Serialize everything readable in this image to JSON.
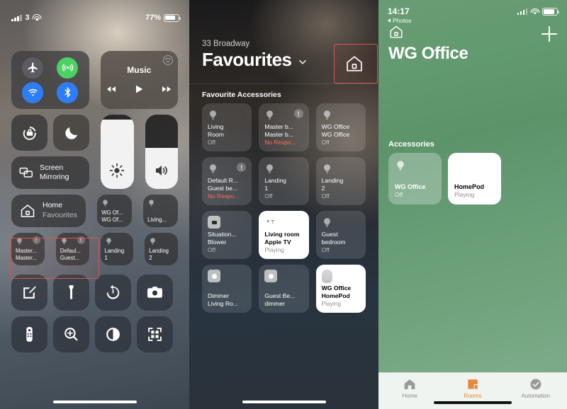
{
  "panel1": {
    "name": "control-centre",
    "status": {
      "carrier": "3",
      "battery_percent": "77%",
      "battery_level": 77
    },
    "connectivity": {
      "airplane": "airplane-mode",
      "cellular": "cellular-data",
      "wifi": "wi-fi",
      "bluetooth": "bluetooth"
    },
    "music": {
      "title": "Music",
      "airplay": "airplay"
    },
    "toggles": {
      "rotation_lock": "rotation-lock",
      "do_not_disturb": "do-not-disturb"
    },
    "screen_mirroring": {
      "line1": "Screen",
      "line2": "Mirroring"
    },
    "sliders": {
      "brightness": 93,
      "volume": 55
    },
    "home_tile": {
      "title": "Home",
      "subtitle": "Favourites"
    },
    "accessories": [
      {
        "line1": "WG Of...",
        "line2": "WG Of...",
        "warn": false
      },
      {
        "line1": "Living...",
        "line2": "",
        "warn": false
      },
      {
        "line1": "Master...",
        "line2": "Master...",
        "warn": true
      },
      {
        "line1": "Defaul...",
        "line2": "Guest...",
        "warn": true
      },
      {
        "line1": "Landing",
        "line2": "1",
        "warn": false
      },
      {
        "line1": "Landing",
        "line2": "2",
        "warn": false
      }
    ],
    "shortcuts": [
      "notes-icon",
      "flashlight-icon",
      "timer-icon",
      "camera-icon",
      "apple-tv-remote-icon",
      "magnifier-icon",
      "dark-mode-icon",
      "qr-scanner-icon"
    ],
    "highlights": [
      "home-tile-highlight"
    ]
  },
  "panel2": {
    "name": "home-favourites",
    "address": "33 Broadway",
    "title": "Favourites",
    "home_button": "home-icon",
    "section_title": "Favourite Accessories",
    "tiles": [
      {
        "name1": "Living",
        "name2": "Room",
        "status": "Off",
        "icon": "bulb-icon",
        "on": false,
        "warn": false,
        "error": false
      },
      {
        "name1": "Master b...",
        "name2": "Master b...",
        "status": "No Respo...",
        "icon": "bulb-icon",
        "on": false,
        "warn": true,
        "error": true
      },
      {
        "name1": "WG Office",
        "name2": "WG Office",
        "status": "Off",
        "icon": "bulb-icon",
        "on": false,
        "warn": false,
        "error": false
      },
      {
        "name1": "Default R...",
        "name2": "Guest be...",
        "status": "No Respo...",
        "icon": "bulb-icon",
        "on": false,
        "warn": true,
        "error": true
      },
      {
        "name1": "Landing",
        "name2": "1",
        "status": "Off",
        "icon": "bulb-icon",
        "on": false,
        "warn": false,
        "error": false
      },
      {
        "name1": "Landing",
        "name2": "2",
        "status": "Off",
        "icon": "bulb-icon",
        "on": false,
        "warn": false,
        "error": false
      },
      {
        "name1": "Situation...",
        "name2": "Blower",
        "status": "Off",
        "icon": "switch-icon",
        "on": false,
        "warn": false,
        "error": false
      },
      {
        "name1": "Living room",
        "name2": "Apple TV",
        "status": "Playing",
        "icon": "apple-tv-icon",
        "on": true,
        "warn": false,
        "error": false
      },
      {
        "name1": "Guest",
        "name2": "bedroom",
        "status": "Off",
        "icon": "bulb-icon",
        "on": false,
        "warn": false,
        "error": false
      },
      {
        "name1": "Dimmer",
        "name2": "Living Ro...",
        "status": "",
        "icon": "dimmer-icon",
        "on": false,
        "warn": false,
        "error": false
      },
      {
        "name1": "Guest Be...",
        "name2": "dimmer",
        "status": "",
        "icon": "dimmer-icon",
        "on": false,
        "warn": false,
        "error": false
      },
      {
        "name1": "WG Office",
        "name2": "HomePod",
        "status": "Playing",
        "icon": "homepod-icon",
        "on": true,
        "warn": false,
        "error": false
      }
    ],
    "highlights": [
      "home-button-highlight"
    ]
  },
  "panel3": {
    "name": "room-wg-office",
    "status": {
      "time": "14:17",
      "back_label": "Photos"
    },
    "nav": {
      "home_icon": "home-icon",
      "add_icon": "plus-icon"
    },
    "title": "WG Office",
    "section_title": "Accessories",
    "tiles": [
      {
        "name": "WG Office",
        "status": "Off",
        "icon": "bulb-icon",
        "on": false
      },
      {
        "name": "HomePod",
        "status": "Playing",
        "icon": "homepod-icon",
        "on": true
      }
    ],
    "tabs": [
      {
        "label": "Home",
        "icon": "home-icon",
        "active": false
      },
      {
        "label": "Rooms",
        "icon": "rooms-icon",
        "active": true
      },
      {
        "label": "Automation",
        "icon": "automation-icon",
        "active": false
      }
    ],
    "accent_color": "#e8883a",
    "background_color": "#5d9369"
  }
}
